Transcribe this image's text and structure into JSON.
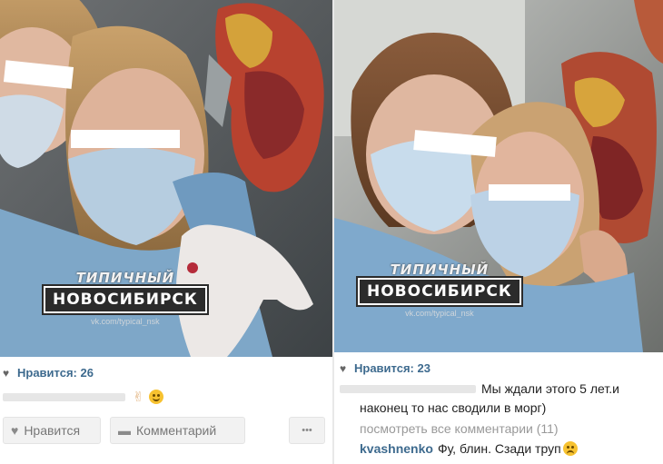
{
  "left_post": {
    "watermark": {
      "line1": "ТИПИЧНЫЙ",
      "line2": "НОВОСИБИРСК",
      "url": "vk.com/typical_nsk"
    },
    "likes_label": "Нравится: 26",
    "actions": {
      "like_label": "Нравится",
      "comment_label": "Комментарий",
      "more_label": "•••"
    }
  },
  "right_post": {
    "watermark": {
      "line1": "ТИПИЧНЫЙ",
      "line2": "НОВОСИБИРСК",
      "url": "vk.com/typical_nsk"
    },
    "likes_label": "Нравится: 23",
    "caption_line1": "Мы ждали этого 5 лет.и",
    "caption_line2": "наконец то нас сводили в морг)",
    "view_all_comments": "посмотреть все комментарии (11)",
    "comment_user": "kvashnenko",
    "comment_text": "Фу, блин. Сзади труп"
  },
  "icons": [
    "heart-icon",
    "comment-icon",
    "more-icon",
    "victory-hand-emoji",
    "grinning-face-emoji",
    "sad-face-emoji"
  ],
  "colors": {
    "like_blue": "#3d6a8e",
    "button_bg": "#f2f2f2",
    "watermark_bg": "#2b2b2b"
  }
}
